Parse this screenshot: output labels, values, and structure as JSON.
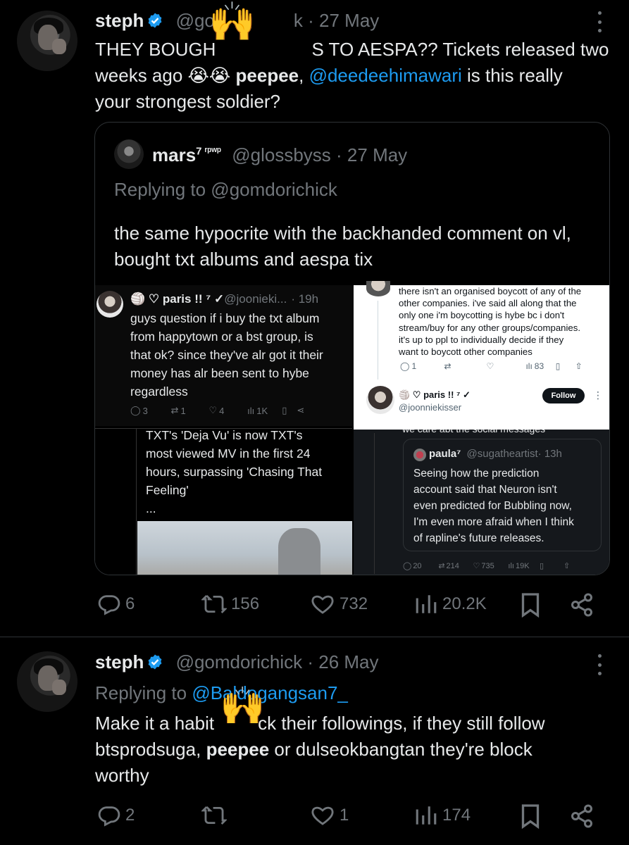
{
  "tweet1": {
    "name": "steph",
    "handle": "@gomdorichick",
    "handle_visible": "@go",
    "handle_visible_end": "k",
    "dot": " · ",
    "date": "27 May",
    "text_line1_a": "THEY BOUGH",
    "text_line1_b": "S TO AESPA?? Tickets released two",
    "text_line2_a": "weeks ago 😭😭 ",
    "text_line2_bold": "peepee",
    "text_line2_b": ", ",
    "text_line2_link": "@deedeehimawari",
    "text_line2_c": " is this really",
    "text_line3": "your strongest soldier?",
    "actions": {
      "replies": "6",
      "reposts": "156",
      "likes": "732",
      "views": "20.2K"
    }
  },
  "quote": {
    "name": "mars",
    "name_sup": "7 ʳᵖʷᵖ",
    "handle": "@glossbyss",
    "dot": " · ",
    "date": "27 May",
    "replying": "Replying to @gomdorichick",
    "text": "the same hypocrite with the backhanded comment on vl, bought txt albums and aespa tix",
    "embedded": {
      "left_tweet": {
        "name": "🏐 ♡ paris !! ⁷ ✓",
        "handle": "@joonieki...",
        "time": "· 19h",
        "lines": [
          "guys question if i buy the txt album",
          "from happytown or a bst group, is",
          "that ok? since they've alr got it their",
          "money has alr been sent to hybe",
          "regardless"
        ],
        "stats": {
          "replies": "3",
          "reposts": "1",
          "likes": "4",
          "views": "1K"
        }
      },
      "white_card": {
        "lines": [
          "there isn't an organised boycott of any of the",
          "other companies. i've said all along that the",
          "only one i'm boycotting is hybe bc i don't",
          "stream/buy for any other groups/companies.",
          "it's up to ppl to individually decide if they",
          "want to boycott other companies"
        ],
        "stats": {
          "replies": "1",
          "views": "83"
        },
        "name": "🏐 ♡ paris !! ⁷ ✓",
        "handle": "@joonniekisser",
        "follow": "Follow"
      },
      "middle_text": [
        "TXT's 'Deja Vu' is now TXT's",
        "most viewed MV in the first 24",
        "hours, surpassing 'Chasing That",
        "Feeling'",
        "..."
      ],
      "right_top": "we care abt the social messages",
      "nested": {
        "name": "paula⁷",
        "handle": "@sugatheartist",
        "time": "· 13h",
        "lines": [
          "Seeing how the prediction",
          "account said that Neuron isn't",
          "even predicted for Bubbling now,",
          "I'm even more afraid when I think",
          "of rapline's future releases."
        ]
      },
      "right_stats": {
        "replies": "20",
        "reposts": "214",
        "likes": "735",
        "views": "19K"
      }
    }
  },
  "tweet2": {
    "name": "steph",
    "handle": "@gomdorichick",
    "dot": " · ",
    "date": "26 May",
    "replying_prefix": "Replying to ",
    "replying_link": "@Baldogangsan7_",
    "text_line1_a": "Make it a habit",
    "text_line1_b": "ck their followings, if they still follow",
    "text_line2_a": "btsprodsuga, ",
    "text_line2_bold": "peepee",
    "text_line2_b": " or dulseokbangtan they're block",
    "text_line3": "worthy",
    "actions": {
      "replies": "2",
      "reposts": "",
      "likes": "1",
      "views": "174"
    }
  },
  "icons": [
    "verified-badge-icon",
    "more-icon",
    "reply-icon",
    "repost-icon",
    "like-icon",
    "views-icon",
    "bookmark-icon",
    "share-icon",
    "raised-hands-emoji"
  ],
  "colors": {
    "background": "#000000",
    "text": "#e7e9ea",
    "muted": "#71767b",
    "link": "#1d9bf0",
    "verified": "#1d9bf0",
    "border": "#2f3336"
  }
}
